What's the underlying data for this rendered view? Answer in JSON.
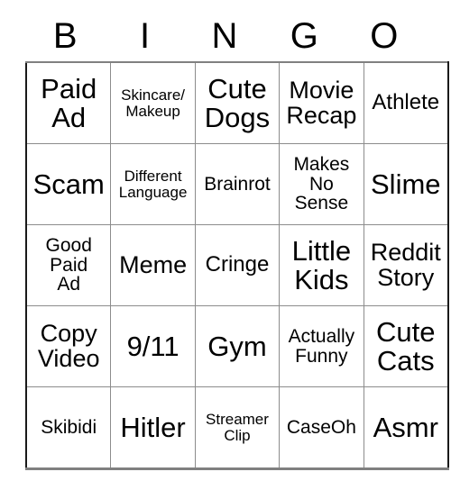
{
  "card": {
    "header_letters": [
      "B",
      "I",
      "N",
      "G",
      "O"
    ],
    "rows": [
      {
        "cells": [
          {
            "text": "Paid\nAd",
            "size": "fs-xxl"
          },
          {
            "text": "Skincare/\nMakeup",
            "size": "fs-s"
          },
          {
            "text": "Cute\nDogs",
            "size": "fs-xxl"
          },
          {
            "text": "Movie\nRecap",
            "size": "fs-xl"
          },
          {
            "text": "Athlete",
            "size": "fs-l"
          }
        ]
      },
      {
        "cells": [
          {
            "text": "Scam",
            "size": "fs-xxl"
          },
          {
            "text": "Different\nLanguage",
            "size": "fs-s"
          },
          {
            "text": "Brainrot",
            "size": "fs-m"
          },
          {
            "text": "Makes\nNo\nSense",
            "size": "fs-m"
          },
          {
            "text": "Slime",
            "size": "fs-xxl"
          }
        ]
      },
      {
        "cells": [
          {
            "text": "Good\nPaid\nAd",
            "size": "fs-m"
          },
          {
            "text": "Meme",
            "size": "fs-xl"
          },
          {
            "text": "Cringe",
            "size": "fs-l"
          },
          {
            "text": "Little\nKids",
            "size": "fs-xxl"
          },
          {
            "text": "Reddit\nStory",
            "size": "fs-xl"
          }
        ]
      },
      {
        "cells": [
          {
            "text": "Copy\nVideo",
            "size": "fs-xl"
          },
          {
            "text": "9/11",
            "size": "fs-xxl"
          },
          {
            "text": "Gym",
            "size": "fs-xxl"
          },
          {
            "text": "Actually\nFunny",
            "size": "fs-m"
          },
          {
            "text": "Cute\nCats",
            "size": "fs-xxl"
          }
        ]
      },
      {
        "cells": [
          {
            "text": "Skibidi",
            "size": "fs-m"
          },
          {
            "text": "Hitler",
            "size": "fs-xxl"
          },
          {
            "text": "Streamer\nClip",
            "size": "fs-s"
          },
          {
            "text": "CaseOh",
            "size": "fs-m"
          },
          {
            "text": "Asmr",
            "size": "fs-xxl"
          }
        ]
      }
    ]
  }
}
